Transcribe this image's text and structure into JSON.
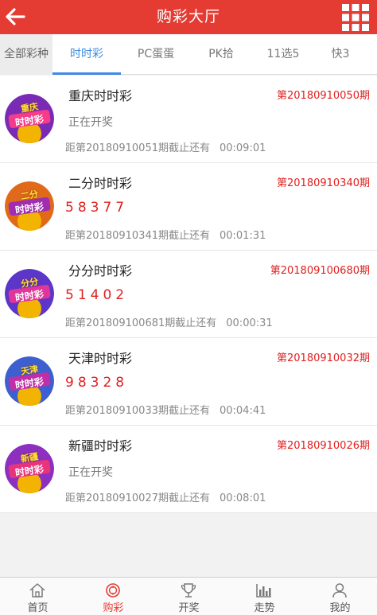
{
  "header": {
    "title": "购彩大厅"
  },
  "tabs": [
    {
      "label": "全部彩种"
    },
    {
      "label": "时时彩"
    },
    {
      "label": "PC蛋蛋"
    },
    {
      "label": "PK拾"
    },
    {
      "label": "11选5"
    },
    {
      "label": "快3"
    }
  ],
  "logo_text": "时时彩",
  "lotteries": [
    {
      "region": "重庆",
      "name": "重庆时时彩",
      "issue": "第20180910050期",
      "status": "正在开奖",
      "numbers": "",
      "deadline": "距第20180910051期截止还有",
      "countdown": "00:09:01"
    },
    {
      "region": "二分",
      "name": "二分时时彩",
      "issue": "第20180910340期",
      "status": "",
      "numbers": "58377",
      "deadline": "距第20180910341期截止还有",
      "countdown": "00:01:31"
    },
    {
      "region": "分分",
      "name": "分分时时彩",
      "issue": "第201809100680期",
      "status": "",
      "numbers": "51402",
      "deadline": "距第201809100681期截止还有",
      "countdown": "00:00:31"
    },
    {
      "region": "天津",
      "name": "天津时时彩",
      "issue": "第20180910032期",
      "status": "",
      "numbers": "98328",
      "deadline": "距第20180910033期截止还有",
      "countdown": "00:04:41"
    },
    {
      "region": "新疆",
      "name": "新疆时时彩",
      "issue": "第20180910026期",
      "status": "正在开奖",
      "numbers": "",
      "deadline": "距第20180910027期截止还有",
      "countdown": "00:08:01"
    }
  ],
  "nav": [
    {
      "label": "首页",
      "icon": "home-icon"
    },
    {
      "label": "购彩",
      "icon": "lottery-icon"
    },
    {
      "label": "开奖",
      "icon": "trophy-icon"
    },
    {
      "label": "走势",
      "icon": "chart-icon"
    },
    {
      "label": "我的",
      "icon": "user-icon"
    }
  ],
  "colors": {
    "primary": "#e43b33",
    "tab_active": "#3f8ae0",
    "highlight": "#e02020"
  }
}
